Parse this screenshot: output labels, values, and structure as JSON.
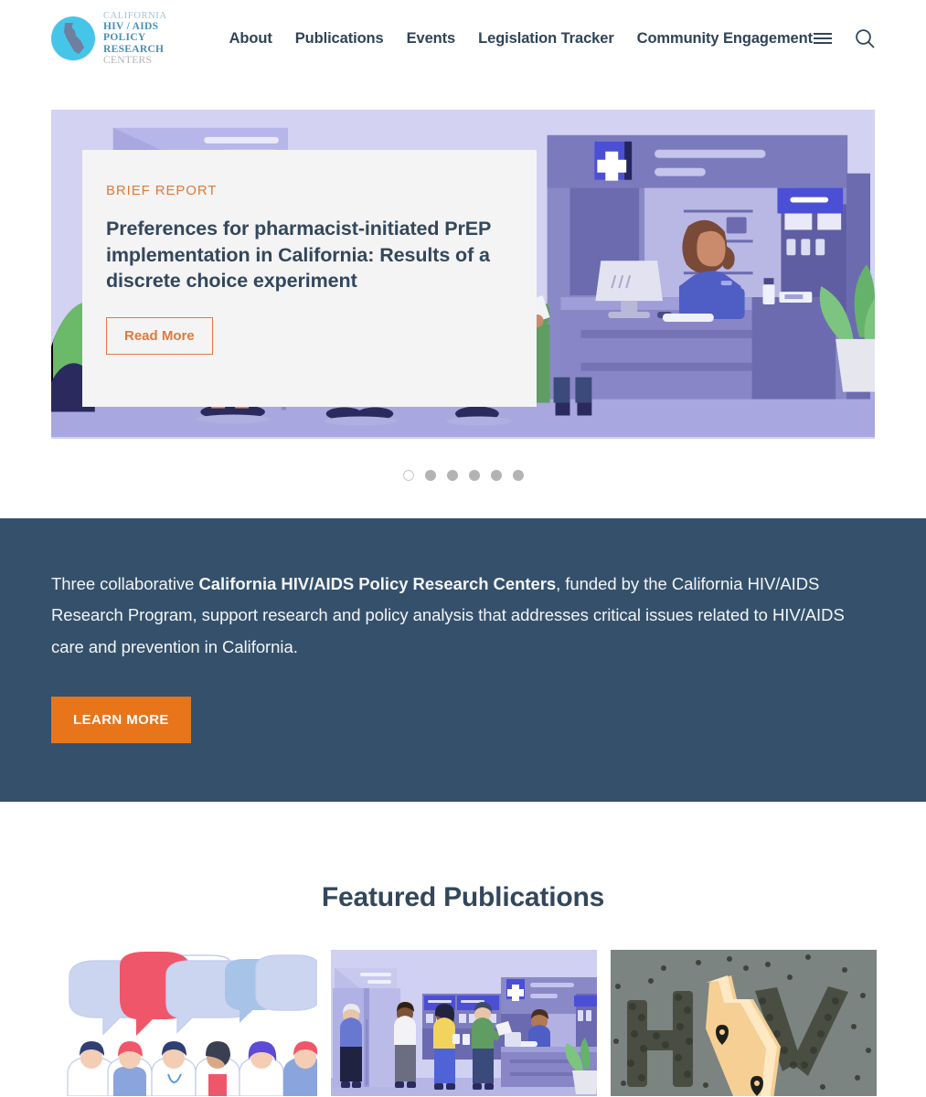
{
  "brand": {
    "line1": "CALIFORNIA",
    "line2": "HIV / AIDS POLICY",
    "line3_strong": "RESEARCH",
    "line3_light": "CENTERS",
    "logo_icon": "california-state-circle-logo"
  },
  "nav": {
    "items": [
      {
        "label": "About"
      },
      {
        "label": "Publications"
      },
      {
        "label": "Events"
      },
      {
        "label": "Legislation Tracker"
      },
      {
        "label": "Community Engagement"
      }
    ],
    "menu_icon": "hamburger-menu-icon",
    "search_icon": "search-icon"
  },
  "hero": {
    "kicker": "BRIEF REPORT",
    "title": "Preferences for pharmacist-initiated PrEP implementation in California: Results of a discrete choice experiment",
    "cta": "Read More",
    "illustration": "pharmacy-counter-illustration",
    "slides_total": 6,
    "active_slide": 1
  },
  "intro": {
    "text_before": "Three collaborative ",
    "text_bold": "California HIV/AIDS Policy Research Centers",
    "text_after": ", funded by the California HIV/AIDS Research Program, support research and policy analysis that addresses critical issues related to HIV/AIDS care and prevention in California.",
    "cta": "LEARN MORE"
  },
  "featured": {
    "heading": "Featured Publications",
    "cards": [
      {
        "image": "healthcare-workers-speech-bubbles-illustration"
      },
      {
        "image": "pharmacy-queue-illustration"
      },
      {
        "image": "hiv-crowd-california-map-photo"
      }
    ]
  },
  "colors": {
    "navy": "#35506a",
    "orange": "#e8751a",
    "orange_text": "#e2793a",
    "brand_cyan": "#45c6e8",
    "hero_lavender": "#d3d2f2"
  }
}
